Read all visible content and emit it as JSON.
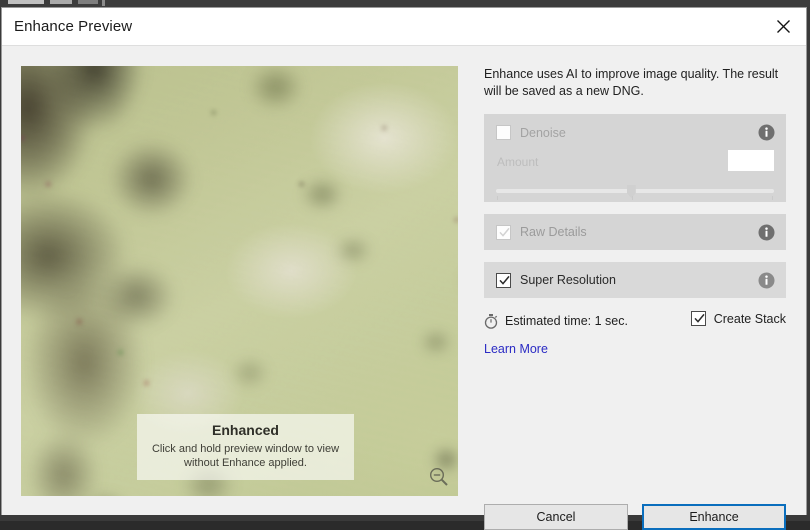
{
  "window": {
    "title": "Enhance Preview",
    "close_icon": "close-icon"
  },
  "preview": {
    "overlay_title": "Enhanced",
    "overlay_subtitle": "Click and hold preview window to view without Enhance applied.",
    "zoom_icon": "zoom-out-magnifier-icon"
  },
  "panel": {
    "intro": "Enhance uses AI to improve image quality. The result will be saved as a new DNG.",
    "denoise": {
      "label": "Denoise",
      "checked": false,
      "disabled": true,
      "info_icon": "info-icon",
      "amount_label": "Amount",
      "amount_value": "",
      "amount_placeholder": ""
    },
    "raw_details": {
      "label": "Raw Details",
      "checked": true,
      "disabled": true,
      "info_icon": "info-icon"
    },
    "super_resolution": {
      "label": "Super Resolution",
      "checked": true,
      "disabled": false,
      "info_icon": "info-icon"
    },
    "estimated_time": {
      "icon": "stopwatch-icon",
      "text": "Estimated time: 1 sec."
    },
    "create_stack": {
      "label": "Create Stack",
      "checked": true
    },
    "learn_more": "Learn More"
  },
  "footer": {
    "cancel_label": "Cancel",
    "enhance_label": "Enhance"
  },
  "colors": {
    "accent": "#0a6ebd",
    "link": "#2b2bc4",
    "dialog_bg": "#f0f0f0",
    "group_bg": "#d5d5d5",
    "titlebar_bg": "#ffffff"
  }
}
